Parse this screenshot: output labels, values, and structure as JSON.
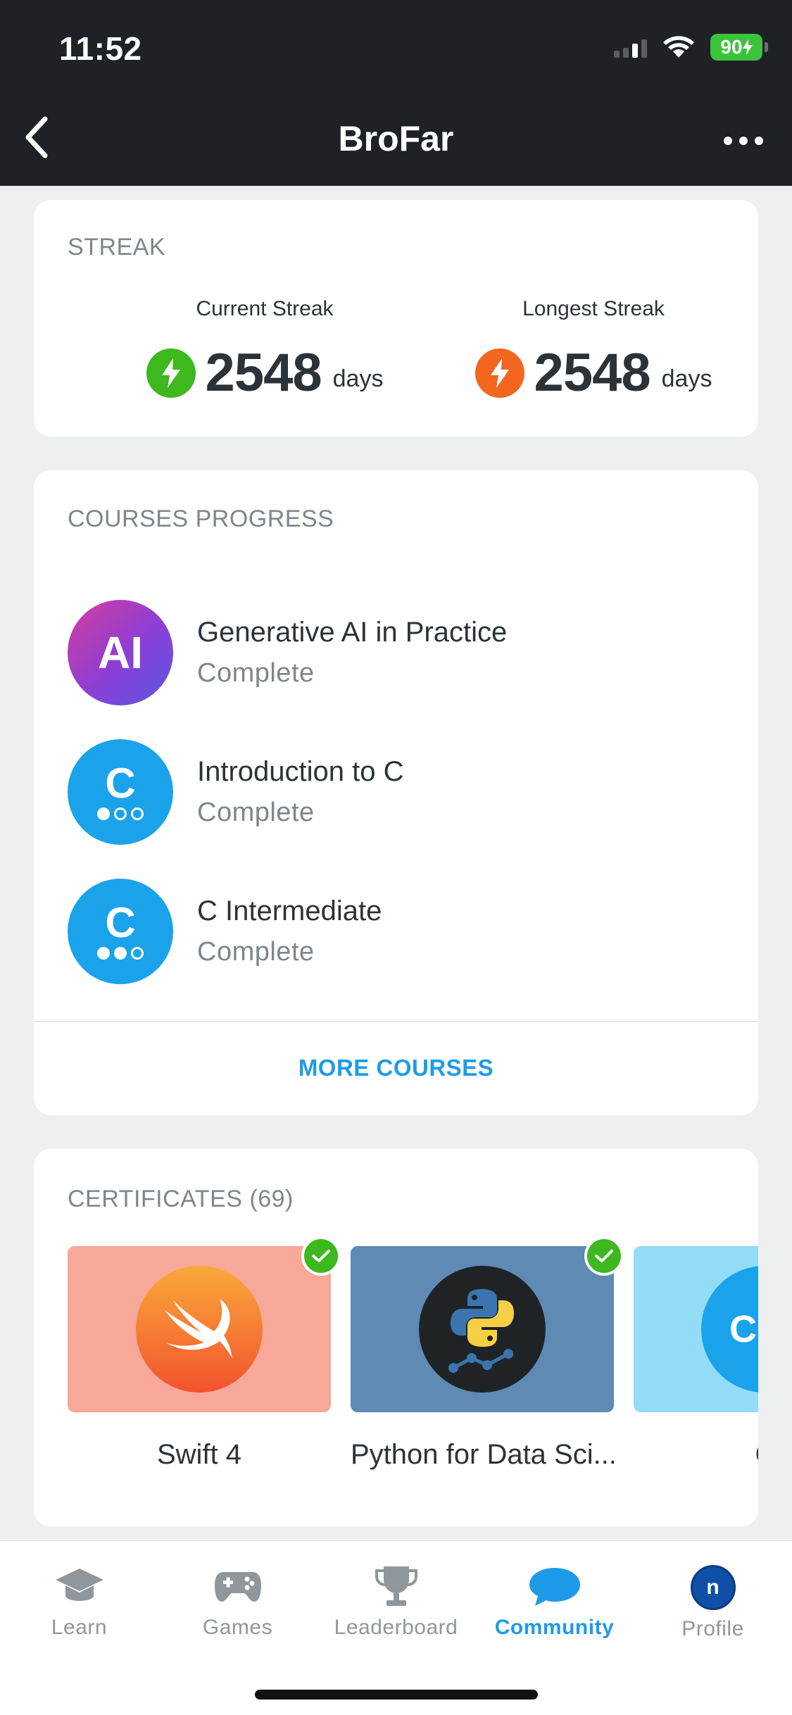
{
  "status_bar": {
    "time": "11:52",
    "battery": "90"
  },
  "nav": {
    "title": "BroFar"
  },
  "streak": {
    "section_title": "STREAK",
    "current": {
      "label": "Current Streak",
      "value": "2548",
      "unit": "days"
    },
    "longest": {
      "label": "Longest Streak",
      "value": "2548",
      "unit": "days"
    }
  },
  "courses": {
    "section_title": "COURSES PROGRESS",
    "items": [
      {
        "icon_text": "AI",
        "name": "Generative AI in Practice",
        "status": "Complete"
      },
      {
        "icon_text": "C",
        "name": "Introduction to C",
        "status": "Complete"
      },
      {
        "icon_text": "C",
        "name": "C Intermediate",
        "status": "Complete"
      }
    ],
    "more_label": "MORE COURSES"
  },
  "certificates": {
    "section_title": "CERTIFICATES (69)",
    "items": [
      {
        "name": "Swift 4",
        "color": "#F8A898"
      },
      {
        "name": "Python for Data Sci...",
        "color": "#5E8AB4"
      },
      {
        "name": "C",
        "icon_text": "C",
        "color": "#93DCF8"
      }
    ]
  },
  "tabbar": {
    "items": [
      {
        "label": "Learn",
        "icon": "graduation-cap-icon"
      },
      {
        "label": "Games",
        "icon": "gamepad-icon"
      },
      {
        "label": "Leaderboard",
        "icon": "trophy-icon"
      },
      {
        "label": "Community",
        "icon": "chat-bubble-icon",
        "active": true
      },
      {
        "label": "Profile",
        "icon": "avatar-icon",
        "avatar_letter": "n"
      }
    ]
  },
  "colors": {
    "accent": "#1E9BE8",
    "success": "#3DB81E",
    "fire": "#F2661F",
    "header": "#1E2125"
  }
}
